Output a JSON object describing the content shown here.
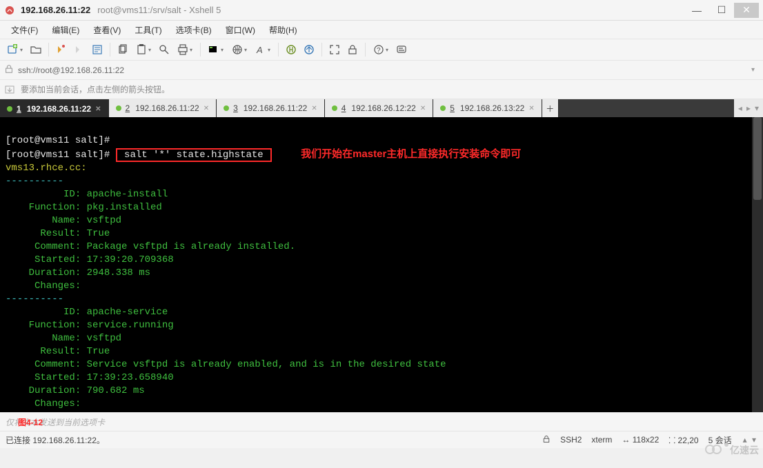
{
  "window": {
    "title_main": "192.168.26.11:22",
    "title_sub": "root@vms11:/srv/salt - Xshell 5"
  },
  "menu": {
    "items": [
      "文件(F)",
      "编辑(E)",
      "查看(V)",
      "工具(T)",
      "选项卡(B)",
      "窗口(W)",
      "帮助(H)"
    ]
  },
  "urlbar": {
    "url": "ssh://root@192.168.26.11:22"
  },
  "hint": {
    "text": "要添加当前会话，点击左侧的箭头按钮。"
  },
  "tabs": [
    {
      "num": "1",
      "label": "192.168.26.11:22",
      "active": true
    },
    {
      "num": "2",
      "label": "192.168.26.11:22",
      "active": false
    },
    {
      "num": "3",
      "label": "192.168.26.11:22",
      "active": false
    },
    {
      "num": "4",
      "label": "192.168.26.12:22",
      "active": false
    },
    {
      "num": "5",
      "label": "192.168.26.13:22",
      "active": false
    }
  ],
  "terminal": {
    "prompt1": "[root@vms11 salt]#",
    "prompt2": "[root@vms11 salt]#",
    "command": " salt '*' state.highstate ",
    "annotation": "我们开始在master主机上直接执行安装命令即可",
    "host_header": "vms13.rhce.cc:",
    "dashes": "----------",
    "st1_id": "          ID: apache-install",
    "st1_function": "    Function: pkg.installed",
    "st1_name": "        Name: vsftpd",
    "st1_result": "      Result: True",
    "st1_comment": "     Comment: Package vsftpd is already installed.",
    "st1_started": "     Started: 17:39:20.709368",
    "st1_duration": "    Duration: 2948.338 ms",
    "st1_changes": "     Changes:",
    "st2_id": "          ID: apache-service",
    "st2_function": "    Function: service.running",
    "st2_name": "        Name: vsftpd",
    "st2_result": "      Result: True",
    "st2_comment": "     Comment: Service vsftpd is already enabled, and is in the desired state",
    "st2_started": "     Started: 17:39:23.658940",
    "st2_duration": "    Duration: 790.682 ms",
    "st2_changes": "     Changes:"
  },
  "composer": {
    "placeholder": "仅将文本发送到当前选项卡",
    "fig_label": "图4-12"
  },
  "status": {
    "conn": "已连接 192.168.26.11:22。",
    "proto": "SSH2",
    "term": "xterm",
    "size": "118x22",
    "pos": "22,20",
    "sessions": "5 会话"
  },
  "watermark": "亿速云"
}
